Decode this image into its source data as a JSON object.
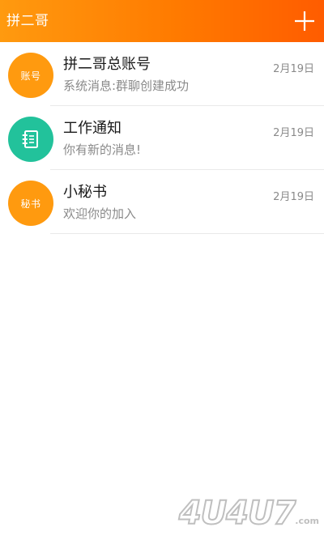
{
  "header": {
    "title": "拼二哥",
    "add_icon": "plus-icon"
  },
  "conversations": [
    {
      "avatar_text": "账号",
      "avatar_color": "#ff9a0f",
      "name": "拼二哥总账号",
      "preview": "系统消息:群聊创建成功",
      "date": "2月19日"
    },
    {
      "avatar_icon": "notebook-icon",
      "avatar_color": "#22c29b",
      "name": "工作通知",
      "preview": "你有新的消息!",
      "date": "2月19日"
    },
    {
      "avatar_text": "秘书",
      "avatar_color": "#ff9a0f",
      "name": "小秘书",
      "preview": "欢迎你的加入",
      "date": "2月19日"
    }
  ],
  "watermark": {
    "text": "4U4U7",
    "suffix": ".com"
  },
  "colors": {
    "header_gradient_start": "#ff9a0f",
    "header_gradient_end": "#ff5c00",
    "accent_orange": "#ff9a0f",
    "accent_teal": "#22c29b"
  }
}
